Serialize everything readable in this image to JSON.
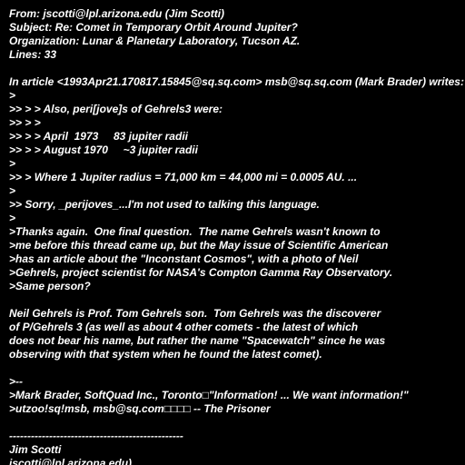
{
  "colors": {
    "background": "#000000",
    "text": "#ffffff"
  },
  "message": {
    "header": {
      "from": "From: jscotti@lpl.arizona.edu (Jim Scotti)",
      "subject": "Subject: Re: Comet in Temporary Orbit Around Jupiter?",
      "organization": "Organization: Lunar & Planetary Laboratory, Tucson AZ.",
      "lines": "Lines: 33"
    },
    "attribution": "In article <1993Apr21.170817.15845@sq.sq.com> msb@sq.sq.com (Mark Brader) writes:",
    "quoted": [
      ">",
      ">> > > Also, peri[jove]s of Gehrels3 were:",
      ">> > >",
      ">> > > April  1973     83 jupiter radii",
      ">> > > August 1970     ~3 jupiter radii",
      ">",
      ">> > Where 1 Jupiter radius = 71,000 km = 44,000 mi = 0.0005 AU. ...",
      ">",
      ">> Sorry, _perijoves_...I'm not used to talking this language.",
      ">",
      ">Thanks again.  One final question.  The name Gehrels wasn't known to",
      ">me before this thread came up, but the May issue of Scientific American",
      ">has an article about the \"Inconstant Cosmos\", with a photo of Neil",
      ">Gehrels, project scientist for NASA's Compton Gamma Ray Observatory.",
      ">Same person?"
    ],
    "reply": [
      "Neil Gehrels is Prof. Tom Gehrels son.  Tom Gehrels was the discoverer",
      "of P/Gehrels 3 (as well as about 4 other comets - the latest of which",
      "does not bear his name, but rather the name \"Spacewatch\" since he was",
      "observing with that system when he found the latest comet)."
    ],
    "quoted_signature": [
      ">--",
      ">Mark Brader, SoftQuad Inc., Toronto□\"Information! ... We want information!\"",
      ">utzoo!sq!msb, msb@sq.com□□□□ -- The Prisoner"
    ],
    "signature": {
      "rule": "------------------------------------------------",
      "name": "Jim Scotti",
      "email": "jscotti@lpl.arizona.edu)"
    }
  }
}
